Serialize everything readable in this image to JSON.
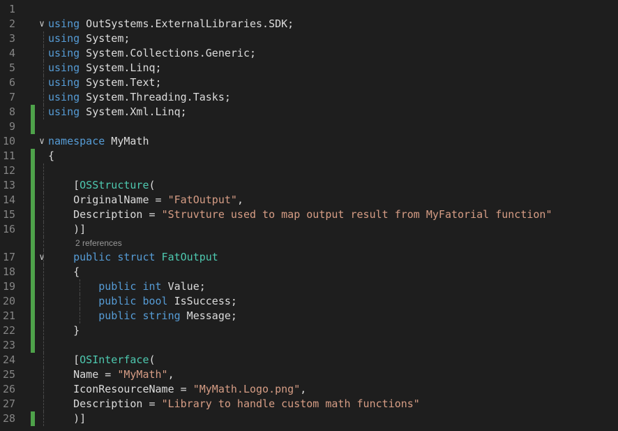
{
  "editor": {
    "colors": {
      "background": "#1e1e1e",
      "line_number": "#858585",
      "keyword": "#569cd6",
      "type": "#4ec9b0",
      "string": "#d69d85",
      "text": "#dcdcdc",
      "change_bar": "#4ea24a",
      "codelens": "#999999"
    },
    "codelens": "2 references",
    "lines": [
      {
        "n": "1",
        "tokens": []
      },
      {
        "n": "2",
        "fold": true,
        "tokens": [
          [
            "kw",
            "using"
          ],
          [
            "ns",
            " OutSystems.ExternalLibraries.SDK;"
          ]
        ]
      },
      {
        "n": "3",
        "tokens": [
          [
            "kw",
            "using"
          ],
          [
            "ns",
            " System;"
          ]
        ]
      },
      {
        "n": "4",
        "tokens": [
          [
            "kw",
            "using"
          ],
          [
            "ns",
            " System.Collections.Generic;"
          ]
        ]
      },
      {
        "n": "5",
        "tokens": [
          [
            "kw",
            "using"
          ],
          [
            "ns",
            " System.Linq;"
          ]
        ]
      },
      {
        "n": "6",
        "tokens": [
          [
            "kw",
            "using"
          ],
          [
            "ns",
            " System.Text;"
          ]
        ]
      },
      {
        "n": "7",
        "tokens": [
          [
            "kw",
            "using"
          ],
          [
            "ns",
            " System.Threading.Tasks;"
          ]
        ]
      },
      {
        "n": "8",
        "changed": true,
        "tokens": [
          [
            "kw",
            "using"
          ],
          [
            "ns",
            " System.Xml.Linq;"
          ]
        ]
      },
      {
        "n": "9",
        "changed": true,
        "tokens": []
      },
      {
        "n": "10",
        "fold": true,
        "tokens": [
          [
            "kw",
            "namespace"
          ],
          [
            "ns",
            " MyMath"
          ]
        ]
      },
      {
        "n": "11",
        "changed": true,
        "tokens": [
          [
            "p",
            "{"
          ]
        ]
      },
      {
        "n": "12",
        "changed": true,
        "tokens": []
      },
      {
        "n": "13",
        "changed": true,
        "tokens": [
          [
            "p",
            "    ["
          ],
          [
            "cls",
            "OSStructure"
          ],
          [
            "p",
            "("
          ]
        ]
      },
      {
        "n": "14",
        "changed": true,
        "tokens": [
          [
            "id",
            "    OriginalName"
          ],
          [
            "p",
            " = "
          ],
          [
            "str",
            "\"FatOutput\""
          ],
          [
            "p",
            ","
          ]
        ]
      },
      {
        "n": "15",
        "changed": true,
        "tokens": [
          [
            "id",
            "    Description"
          ],
          [
            "p",
            " = "
          ],
          [
            "str",
            "\"Struvture used to map output result from MyFatorial function\""
          ]
        ]
      },
      {
        "n": "16",
        "changed": true,
        "tokens": [
          [
            "p",
            "    )]"
          ]
        ],
        "lens_after": true
      },
      {
        "n": "17",
        "changed": true,
        "fold": true,
        "tokens": [
          [
            "kw",
            "    public"
          ],
          [
            "kw",
            " struct"
          ],
          [
            "cls",
            " FatOutput"
          ]
        ]
      },
      {
        "n": "18",
        "changed": true,
        "tokens": [
          [
            "p",
            "    {"
          ]
        ]
      },
      {
        "n": "19",
        "changed": true,
        "tokens": [
          [
            "kw",
            "        public"
          ],
          [
            "kw",
            " int"
          ],
          [
            "id",
            " Value"
          ],
          [
            "p",
            ";"
          ]
        ]
      },
      {
        "n": "20",
        "changed": true,
        "tokens": [
          [
            "kw",
            "        public"
          ],
          [
            "kw",
            " bool"
          ],
          [
            "id",
            " IsSuccess"
          ],
          [
            "p",
            ";"
          ]
        ]
      },
      {
        "n": "21",
        "changed": true,
        "tokens": [
          [
            "kw",
            "        public"
          ],
          [
            "kw",
            " string"
          ],
          [
            "id",
            " Message"
          ],
          [
            "p",
            ";"
          ]
        ]
      },
      {
        "n": "22",
        "changed": true,
        "tokens": [
          [
            "p",
            "    }"
          ]
        ]
      },
      {
        "n": "23",
        "changed": true,
        "tokens": []
      },
      {
        "n": "24",
        "tokens": [
          [
            "p",
            "    ["
          ],
          [
            "cls",
            "OSInterface"
          ],
          [
            "p",
            "("
          ]
        ]
      },
      {
        "n": "25",
        "tokens": [
          [
            "id",
            "    Name"
          ],
          [
            "p",
            " = "
          ],
          [
            "str",
            "\"MyMath\""
          ],
          [
            "p",
            ","
          ]
        ]
      },
      {
        "n": "26",
        "tokens": [
          [
            "id",
            "    IconResourceName"
          ],
          [
            "p",
            " = "
          ],
          [
            "str",
            "\"MyMath.Logo.png\""
          ],
          [
            "p",
            ","
          ]
        ]
      },
      {
        "n": "27",
        "tokens": [
          [
            "id",
            "    Description"
          ],
          [
            "p",
            " = "
          ],
          [
            "str",
            "\"Library to handle custom math functions\""
          ]
        ]
      },
      {
        "n": "28",
        "changed": true,
        "tokens": [
          [
            "p",
            "    )]"
          ]
        ]
      }
    ]
  }
}
